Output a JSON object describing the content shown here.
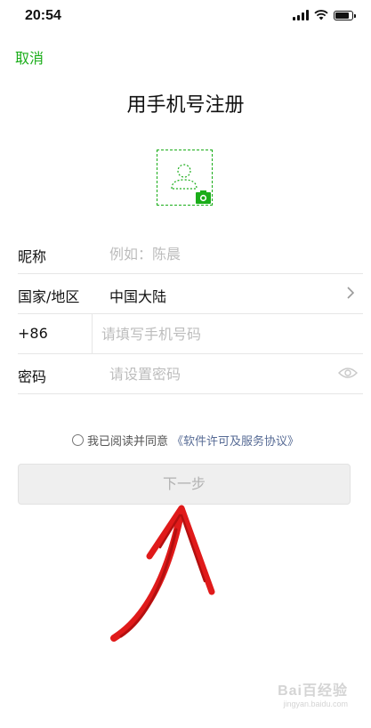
{
  "status_bar": {
    "time": "20:54"
  },
  "header": {
    "cancel_label": "取消",
    "title": "用手机号注册"
  },
  "form": {
    "nickname": {
      "label": "昵称",
      "placeholder": "例如：陈晨"
    },
    "region": {
      "label": "国家/地区",
      "value": "中国大陆"
    },
    "phone": {
      "code": "+86",
      "placeholder": "请填写手机号码"
    },
    "password": {
      "label": "密码",
      "placeholder": "请设置密码"
    }
  },
  "agreement": {
    "prefix": "我已阅读并同意",
    "link": "《软件许可及服务协议》"
  },
  "next_button": {
    "label": "下一步"
  },
  "watermark": {
    "text": "Bai百经验",
    "sub": "jingyan.baidu.com"
  },
  "colors": {
    "accent": "#1aad19",
    "link": "#576b95",
    "arrow": "#e01a1a"
  }
}
